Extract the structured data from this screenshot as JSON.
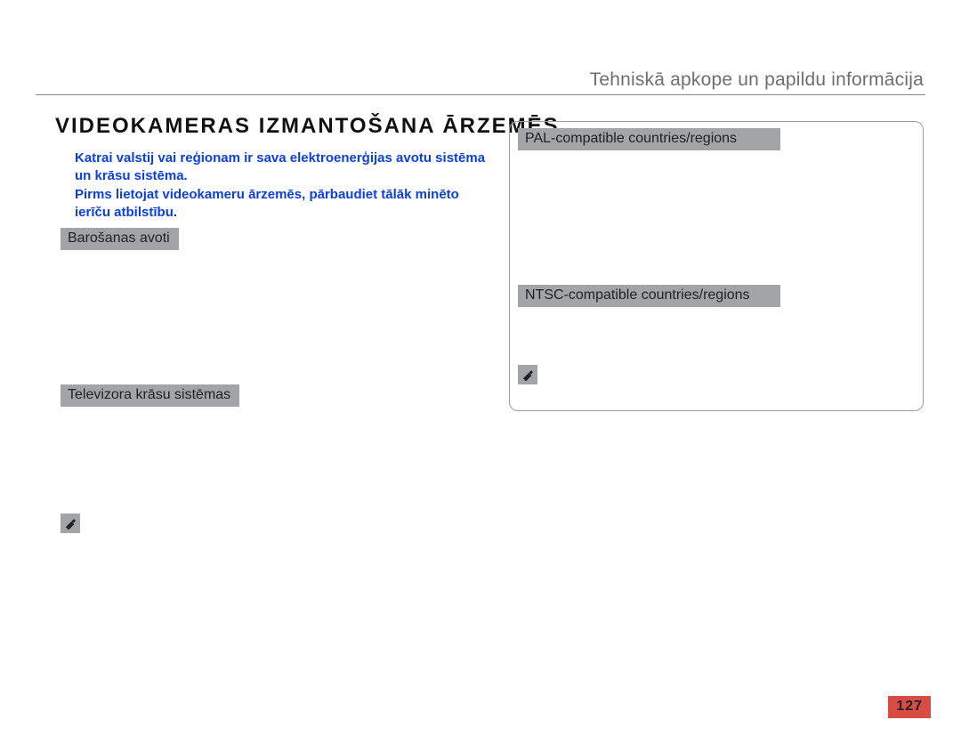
{
  "header": {
    "section_title": "Tehniskā apkope un papildu informācija"
  },
  "main": {
    "title": "VIDEOKAMERAS IZMANTOŠANA ĀRZEMĒS",
    "blue_warning_lines": [
      "Katrai valstij vai reģionam ir sava elektroenerģijas avotu sistēma un krāsu sistēma.",
      "Pirms lietojat videokameru ārzemēs, pārbaudiet tālāk minēto ierīču atbilstību."
    ]
  },
  "left": {
    "power_sources_heading": "Barošanas avoti",
    "tv_systems_heading": "Televizora krāsu sistēmas"
  },
  "right": {
    "pal_heading": "PAL-compatible countries/regions",
    "ntsc_heading": "NTSC-compatible countries/regions"
  },
  "icons": {
    "note": "note-icon"
  },
  "page_number": "127"
}
